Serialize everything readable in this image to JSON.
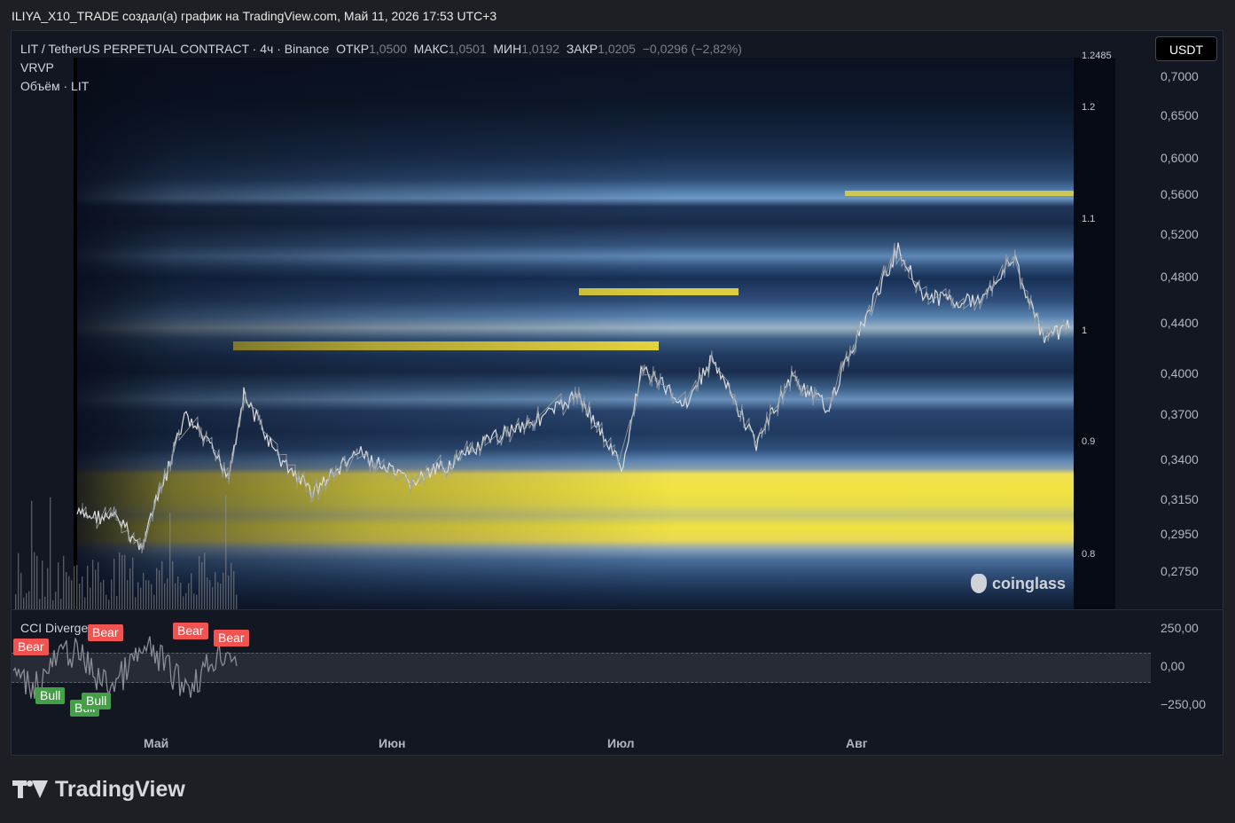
{
  "caption": "ILIYA_X10_TRADE создал(а) график на TradingView.com, Май 11, 2026 17:53 UTC+3",
  "legend": {
    "symbol": "LIT / TetherUS PERPETUAL CONTRACT · 4ч · Binance",
    "open_label": "ОТКР",
    "open_value": "1,0500",
    "high_label": "МАКС",
    "high_value": "1,0501",
    "low_label": "МИН",
    "low_value": "1,0192",
    "close_label": "ЗАКР",
    "close_value": "1,0205",
    "change": "−0,0296 (−2,82%)",
    "indicator_vrvp": "VRVP",
    "indicator_volume": "Объём · LIT"
  },
  "currency_button": "USDT",
  "watermark": "coinglass",
  "price_axis": [
    "0,7000",
    "0,6500",
    "0,6000",
    "0,5600",
    "0,5200",
    "0,4800",
    "0,4400",
    "0,4000",
    "0,3700",
    "0,3400",
    "0,3150",
    "0,2950",
    "0,2750"
  ],
  "heatmap_axis": [
    "1.2485",
    "1.2",
    "1.1",
    "1",
    "0.9",
    "0.8"
  ],
  "cci": {
    "label": "CCI Divergence",
    "axis": [
      "250,00",
      "0,00",
      "−250,00"
    ],
    "badges": [
      {
        "type": "bear",
        "text": "Bear"
      },
      {
        "type": "bear",
        "text": "Bear"
      },
      {
        "type": "bear",
        "text": "Bear"
      },
      {
        "type": "bear",
        "text": "Bear"
      },
      {
        "type": "bull",
        "text": "Bull"
      },
      {
        "type": "bull",
        "text": "Bull"
      },
      {
        "type": "bull",
        "text": "Bull"
      }
    ]
  },
  "time_axis": [
    "Май",
    "Июн",
    "Июл",
    "Авг"
  ],
  "footer_brand": "TradingView",
  "colors": {
    "background": "#131722",
    "bear": "#f05350",
    "bull": "#43a047",
    "heat_high": "#f0e23d",
    "heat_low": "#0b1222"
  }
}
